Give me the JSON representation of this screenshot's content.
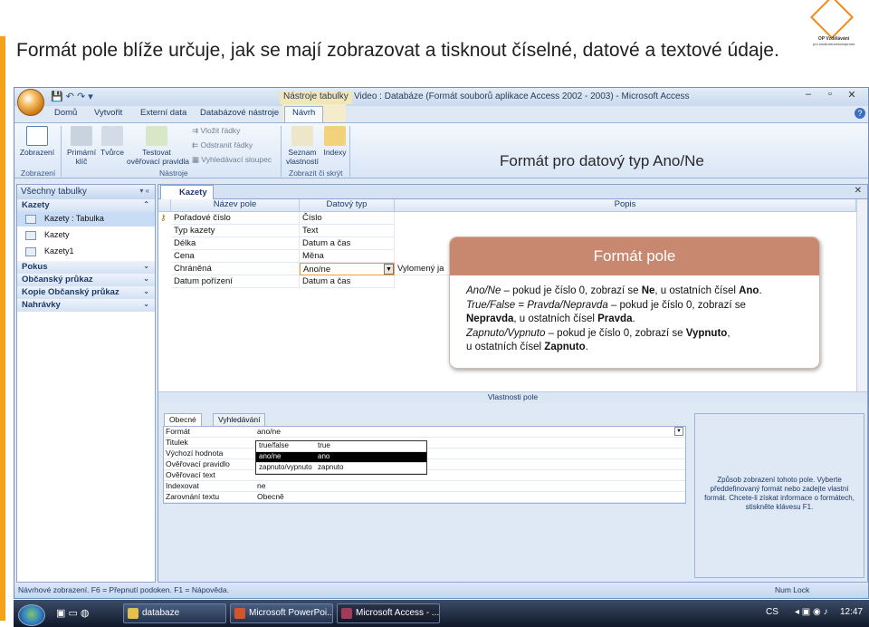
{
  "slide": {
    "title": "Formát pole blíže určuje, jak se mají zobrazovat a tisknout číselné, datové a textové údaje.",
    "logo_line1": "OP Vzdělávání",
    "logo_line2": "pro konkurenceschopnost",
    "callout_title": "Formát pro datový typ Ano/Ne",
    "box_title": "Formát pole",
    "box_lines": {
      "l1a": "Ano/Ne",
      "l1b": " – pokud je číslo 0, zobrazí se ",
      "l1c": "Ne",
      "l1d": ", u ostatních čísel ",
      "l1e": "Ano",
      "l1f": ".",
      "l2a": "True/False = Pravda/Nepravda",
      "l2b": " – pokud je číslo 0, zobrazí se ",
      "l2c": "Nepravda",
      "l2d": ", u ostatních čísel ",
      "l2e": "Pravda",
      "l2f": ".",
      "l3a": "Zapnuto/Vypnuto",
      "l3b": " – pokud je číslo 0, zobrazí se ",
      "l3c": "Vypnuto",
      "l3d": ",",
      "l3e": "u ostatních čísel ",
      "l3f": "Zapnuto",
      "l3g": "."
    }
  },
  "window": {
    "title": "Video : Databáze (Formát souborů aplikace Access 2002 - 2003) - Microsoft Access",
    "context_title": "Nástroje tabulky",
    "min": "–",
    "max": "▫",
    "close": "✕"
  },
  "tabs": [
    "Domů",
    "Vytvořit",
    "Externí data",
    "Databázové nástroje",
    "Návrh"
  ],
  "ribbon": {
    "zobrazeni": "Zobrazení",
    "primarni": "Primární",
    "klic": "klíč",
    "tvurce": "Tvůrce",
    "testovat": "Testovat",
    "overovaci": "ověřovací pravidla",
    "vlozit": "Vložit řádky",
    "odstranit": "Odstranit řádky",
    "vyhledavaci": "Vyhledávací sloupec",
    "seznam": "Seznam",
    "vlastnosti": "vlastností",
    "indexy": "Indexy",
    "grp_zobrazeni": "Zobrazení",
    "grp_nastroje": "Nástroje",
    "grp_zobrazit": "Zobrazit či skrýt"
  },
  "nav": {
    "header": "Všechny tabulky",
    "groups": [
      "Kazety",
      "Pokus",
      "Občanský průkaz",
      "Kopie Občanský průkaz",
      "Nahrávky"
    ],
    "items": [
      "Kazety : Tabulka",
      "Kazety",
      "Kazety1"
    ]
  },
  "doc": {
    "tab": "Kazety",
    "col_name": "Název pole",
    "col_type": "Datový typ",
    "col_desc": "Popis",
    "rows": [
      {
        "name": "Pořadové číslo",
        "type": "Číslo"
      },
      {
        "name": "Typ kazety",
        "type": "Text"
      },
      {
        "name": "Délka",
        "type": "Datum a čas"
      },
      {
        "name": "Cena",
        "type": "Měna"
      },
      {
        "name": "Chráněná",
        "type": "Ano/ne",
        "desc": "Vylomený ja"
      },
      {
        "name": "Datum pořízení",
        "type": "Datum a čas"
      }
    ]
  },
  "props": {
    "title": "Vlastnosti pole",
    "tab_general": "Obecné",
    "tab_lookup": "Vyhledávání",
    "rows": [
      {
        "label": "Formát",
        "value": "ano/ne"
      },
      {
        "label": "Titulek",
        "value": ""
      },
      {
        "label": "Výchozí hodnota",
        "value": ""
      },
      {
        "label": "Ověřovací pravidlo",
        "value": ""
      },
      {
        "label": "Ověřovací text",
        "value": ""
      },
      {
        "label": "Indexovat",
        "value": "ne"
      },
      {
        "label": "Zarovnání textu",
        "value": "Obecně"
      }
    ],
    "dropdown": [
      {
        "a": "true/false",
        "b": "true"
      },
      {
        "a": "ano/ne",
        "b": "ano"
      },
      {
        "a": "zapnuto/vypnuto",
        "b": "zapnuto"
      }
    ],
    "help": "Způsob zobrazení tohoto pole. Vyberte předdefinovaný formát nebo zadejte vlastní formát. Chcete-li získat informace o formátech, stiskněte klávesu F1."
  },
  "status": {
    "left": "Návrhové zobrazení.  F6 = Přepnutí podoken.  F1 = Nápověda.",
    "numlock": "Num Lock"
  },
  "taskbar": {
    "items": [
      "databaze",
      "Microsoft PowerPoi...",
      "Microsoft Access - ..."
    ],
    "lang": "CS",
    "time": "12:47"
  },
  "colors": {
    "accent_orange": "#f4a21a",
    "box_header": "#c8886f",
    "ribbon_blue": "#dfe8f5"
  }
}
